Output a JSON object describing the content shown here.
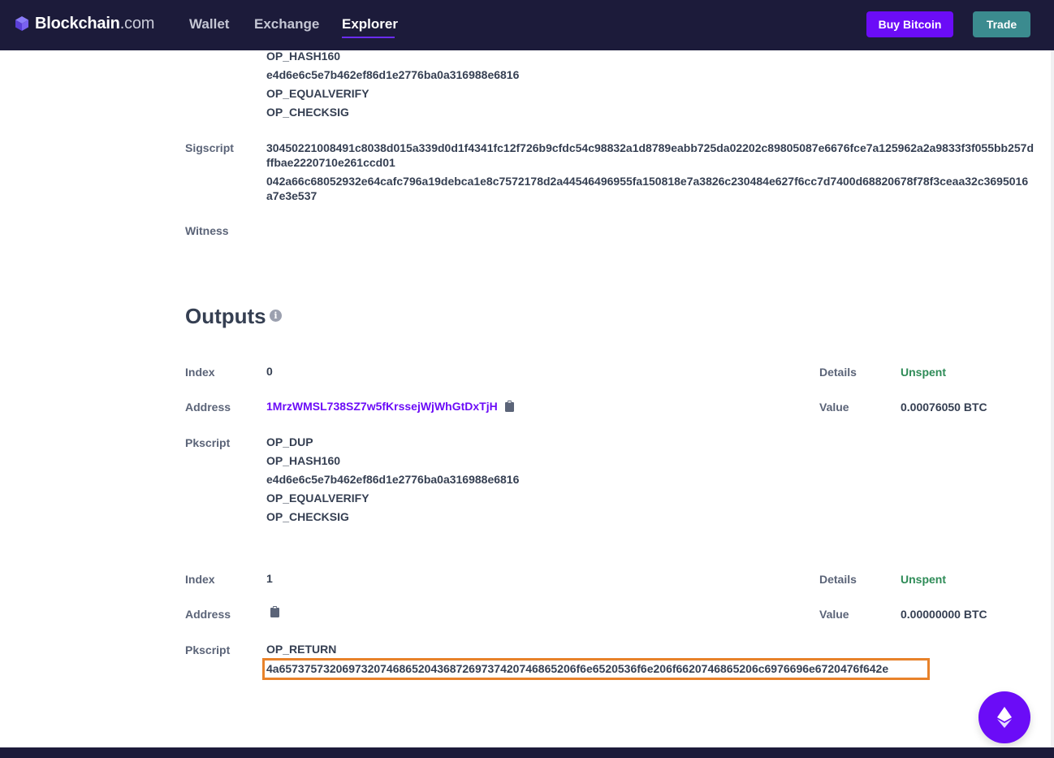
{
  "nav": {
    "brand_main": "Blockchain",
    "brand_tld": ".com",
    "links": [
      "Wallet",
      "Exchange",
      "Explorer"
    ],
    "active": "Explorer",
    "buy_label": "Buy Bitcoin",
    "trade_label": "Trade"
  },
  "input_partial": {
    "pkscript_lines": [
      "OP_HASH160",
      "e4d6e6c5e7b462ef86d1e2776ba0a316988e6816",
      "OP_EQUALVERIFY",
      "OP_CHECKSIG"
    ],
    "sigscript_label": "Sigscript",
    "sigscript_lines": [
      "30450221008491c8038d015a339d0d1f4341fc12f726b9cfdc54c98832a1d8789eabb725da02202c89805087e6676fce7a125962a2a9833f3f055bb257dffbae2220710e261ccd01",
      "042a66c68052932e64cafc796a19debca1e8c7572178d2a44546496955fa150818e7a3826c230484e627f6cc7d7400d68820678f78f3ceaa32c3695016a7e3e537"
    ],
    "witness_label": "Witness"
  },
  "outputs": {
    "title": "Outputs",
    "info_icon": "info-icon",
    "labels": {
      "index": "Index",
      "address": "Address",
      "pkscript": "Pkscript",
      "details": "Details",
      "value": "Value"
    },
    "items": [
      {
        "index": "0",
        "address": "1MrzWMSL738SZ7w5fKrssejWjWhGtDxTjH",
        "details": "Unspent",
        "value": "0.00076050 BTC",
        "pkscript_lines": [
          "OP_DUP",
          "OP_HASH160",
          "e4d6e6c5e7b462ef86d1e2776ba0a316988e6816",
          "OP_EQUALVERIFY",
          "OP_CHECKSIG"
        ]
      },
      {
        "index": "1",
        "address": "",
        "details": "Unspent",
        "value": "0.00000000 BTC",
        "pkscript_lines": [
          "OP_RETURN",
          "4a65737573206973207468652043687269737420746865206f6e6520536f6e206f6620746865206c6976696e6720476f642e"
        ]
      }
    ]
  },
  "colors": {
    "nav_bg": "#1c1b3a",
    "brand_purple": "#6b0cf7",
    "trade_teal": "#3b8b8f",
    "unspent_green": "#2e8b57",
    "highlight_orange": "#e8822a"
  }
}
